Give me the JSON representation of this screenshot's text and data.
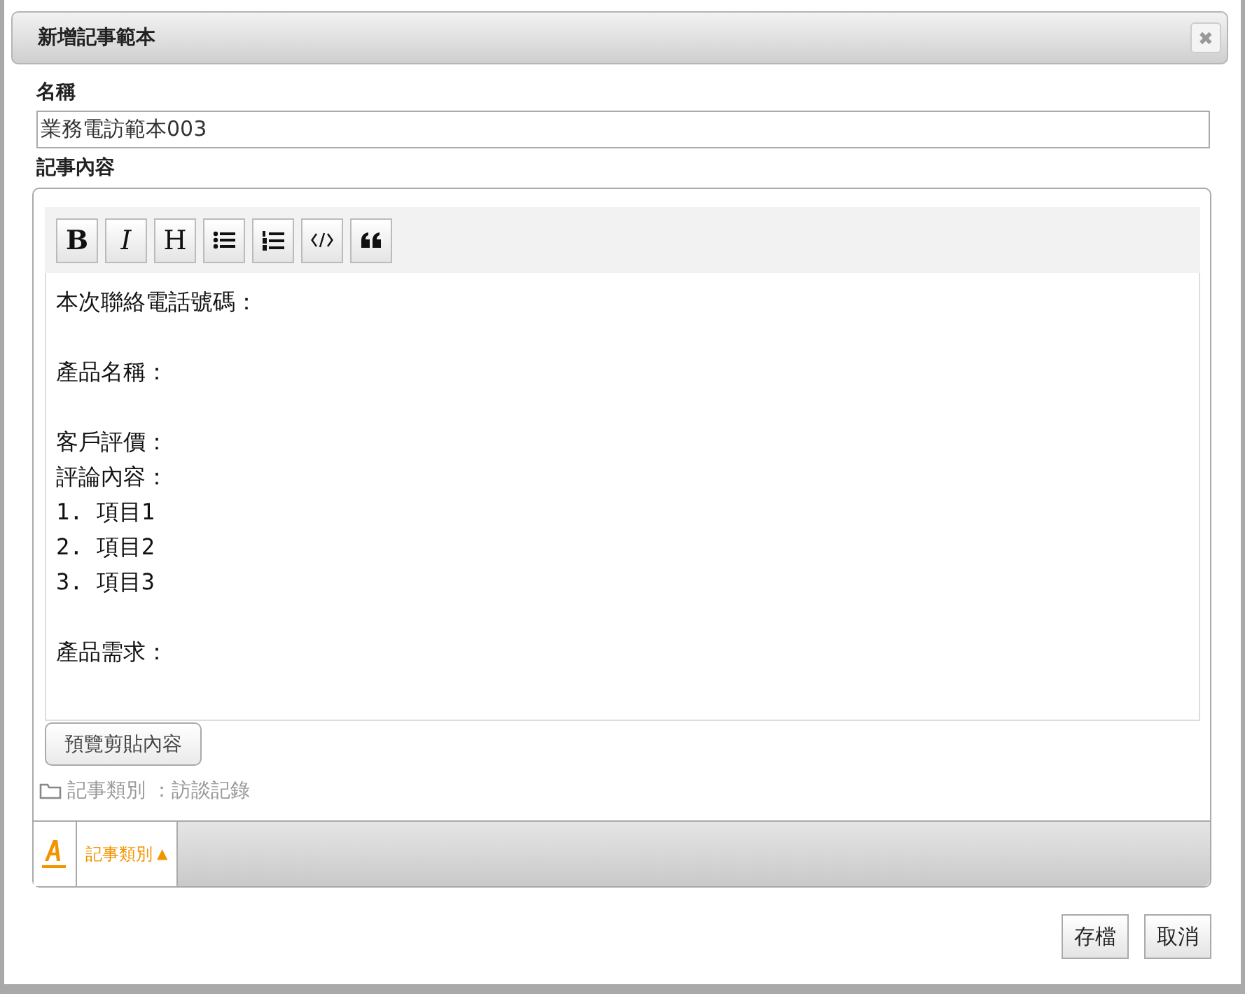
{
  "dialog": {
    "title": "新增記事範本",
    "close": "✖"
  },
  "name_field": {
    "label": "名稱",
    "value": "業務電訪範本003"
  },
  "content": {
    "label": "記事內容",
    "toolbar": [
      {
        "kind": "bold",
        "label": "B"
      },
      {
        "kind": "italic",
        "label": "I"
      },
      {
        "kind": "heading",
        "label": "H"
      },
      {
        "kind": "bullet-list"
      },
      {
        "kind": "numbered-list"
      },
      {
        "kind": "code"
      },
      {
        "kind": "quote"
      }
    ],
    "paragraphs": [
      {
        "lines": [
          "本次聯絡電話號碼："
        ]
      },
      {
        "lines": [
          "產品名稱："
        ]
      },
      {
        "lines": [
          "客戶評價：",
          "評論內容：",
          "1. 項目1",
          "2. 項目2",
          "3. 項目3"
        ]
      },
      {
        "lines": [
          "產品需求："
        ]
      }
    ]
  },
  "preview_button": "預覽剪貼內容",
  "category_line": "記事類別 ：訪談記錄",
  "bottom_bar": {
    "tab": "記事類別",
    "tab_arrow": "▲"
  },
  "buttons": [
    "存檔",
    "取消"
  ]
}
